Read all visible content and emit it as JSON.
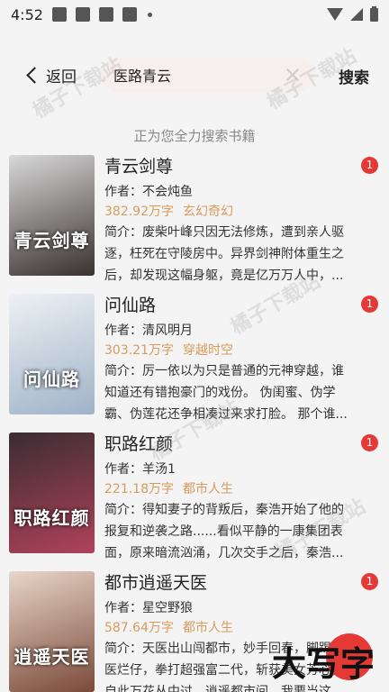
{
  "status": {
    "time": "4:52"
  },
  "header": {
    "back_label": "返回",
    "search_value": "医路青云",
    "search_button": "搜索"
  },
  "hint": "正为您全力搜索书籍",
  "watermark": "橘子下载站",
  "corner_mark": "大写字",
  "books": [
    {
      "title": "青云剑尊",
      "author": "作者：不会炖鱼",
      "words": "382.92万字",
      "genre": "玄幻奇幻",
      "intro": "简介：废柴叶峰只因无法修炼，遭到亲人驱逐，枉死在守陵房中。异界剑神附体重生之后，却发现这幅身躯，竟是亿万万人中，...",
      "badge": "1",
      "cover_text": "青云剑尊",
      "cover_colors": [
        "#d9d9d9",
        "#3a3030"
      ]
    },
    {
      "title": "问仙路",
      "author": "作者：清风明月",
      "words": "303.21万字",
      "genre": "穿越时空",
      "intro": "简介：厉一依以为只是普通的元神穿越，谁知道还有错抱豪门的戏份。 伪闺蜜、伪学霸、伪莲花还争相凑过来求打脸。 那个谁...",
      "badge": "1",
      "cover_text": "问仙路",
      "cover_colors": [
        "#eef1f4",
        "#9fb3c8"
      ]
    },
    {
      "title": "职路红颜",
      "author": "作者：羊汤1",
      "words": "221.18万字",
      "genre": "都市人生",
      "intro": "简介：得知妻子的背叛后，秦浩开始了他的报复和逆袭之路......看似平静的一康集团表面，原来暗流汹涌，几次交手之后，秦浩...",
      "badge": "1",
      "cover_text": "职路红颜",
      "cover_colors": [
        "#3a2d33",
        "#b0425a"
      ]
    },
    {
      "title": "都市逍遥天医",
      "author": "作者：星空野狼",
      "words": "587.64万字",
      "genre": "都市人生",
      "intro": "简介：天医出山闯都市，妙手回春，脚踢恶医烂仔，拳打超强富二代，斩获美女芳心，自此万花丛中过，逍遥都市间。我要当这...",
      "badge": "1",
      "cover_text": "逍遥天医",
      "cover_colors": [
        "#e8d6c8",
        "#7a4a3a"
      ]
    }
  ]
}
